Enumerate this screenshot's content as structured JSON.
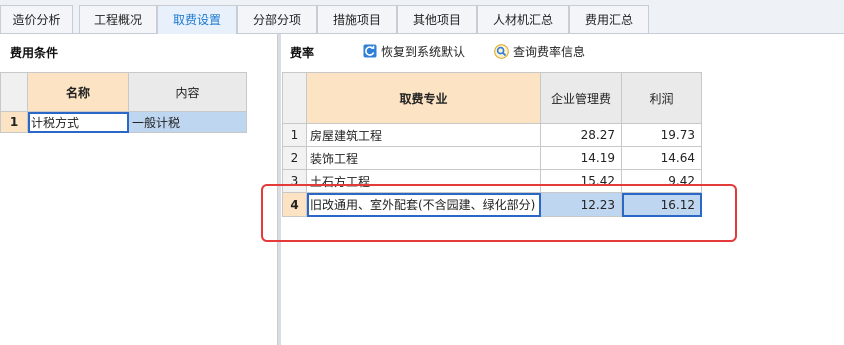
{
  "tabs": [
    {
      "label": "造价分析"
    },
    {
      "label": "工程概况"
    },
    {
      "label": "取费设置"
    },
    {
      "label": "分部分项"
    },
    {
      "label": "措施项目"
    },
    {
      "label": "其他项目"
    },
    {
      "label": "人材机汇总"
    },
    {
      "label": "费用汇总"
    }
  ],
  "active_tab": "取费设置",
  "left": {
    "title": "费用条件",
    "columns": [
      "名称",
      "内容"
    ],
    "rows": [
      {
        "num": "1",
        "name": "计税方式",
        "value": "一般计税"
      }
    ]
  },
  "right": {
    "title": "费率",
    "restore_label": "恢复到系统默认",
    "query_label": "查询费率信息",
    "columns": [
      "取费专业",
      "企业管理费",
      "利润"
    ],
    "rows": [
      {
        "num": "1",
        "name": "房屋建筑工程",
        "mgmt": "28.27",
        "profit": "19.73"
      },
      {
        "num": "2",
        "name": "装饰工程",
        "mgmt": "14.19",
        "profit": "14.64"
      },
      {
        "num": "3",
        "name": "土石方工程",
        "mgmt": "15.42",
        "profit": "9.42"
      },
      {
        "num": "4",
        "name": "旧改通用、室外配套(不含园建、绿化部分)",
        "mgmt": "12.23",
        "profit": "16.12"
      }
    ]
  },
  "colors": {
    "selected_header": "#fbe3c4",
    "selected_row": "#bfd6f1",
    "focus_border": "#2b67c7",
    "annotation": "#e53a3a",
    "active_tab_text": "#1f7ad1"
  },
  "icons": [
    "restore-icon",
    "query-rate-icon"
  ]
}
